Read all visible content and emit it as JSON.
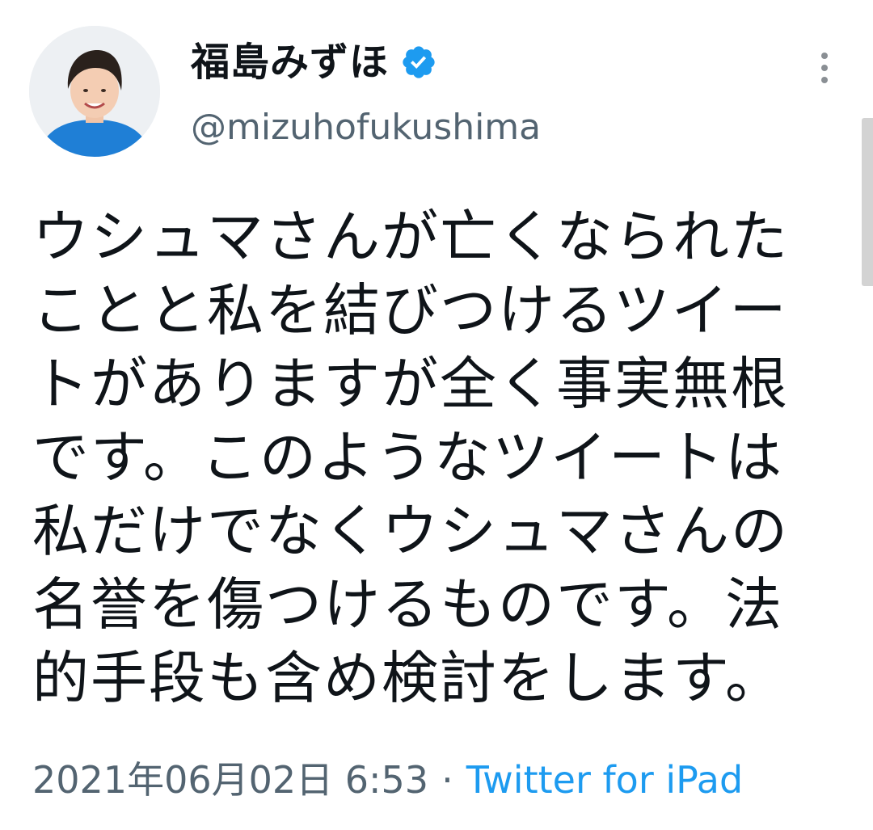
{
  "tweet": {
    "author": {
      "display_name": "福島みずほ",
      "handle": "@mizuhofukushima",
      "verified": true,
      "verified_icon": "verified-badge-icon",
      "verified_color": "#1d9bf0"
    },
    "more_icon": "more-vertical-icon",
    "text_lines": [
      "ウシュマさんが亡くなられた",
      "ことと私を結びつけるツイー",
      "トがありますが全く事実無根",
      "です。このようなツイートは",
      "私だけでなくウシュマさんの",
      "名誉を傷つけるものです。法",
      "的手段も含め検討をします。"
    ],
    "timestamp": "2021年06月02日 6:53",
    "separator": "·",
    "source": "Twitter for iPad"
  },
  "colors": {
    "text": "#0f1419",
    "secondary": "#536471",
    "link": "#1d9bf0",
    "background": "#ffffff"
  }
}
